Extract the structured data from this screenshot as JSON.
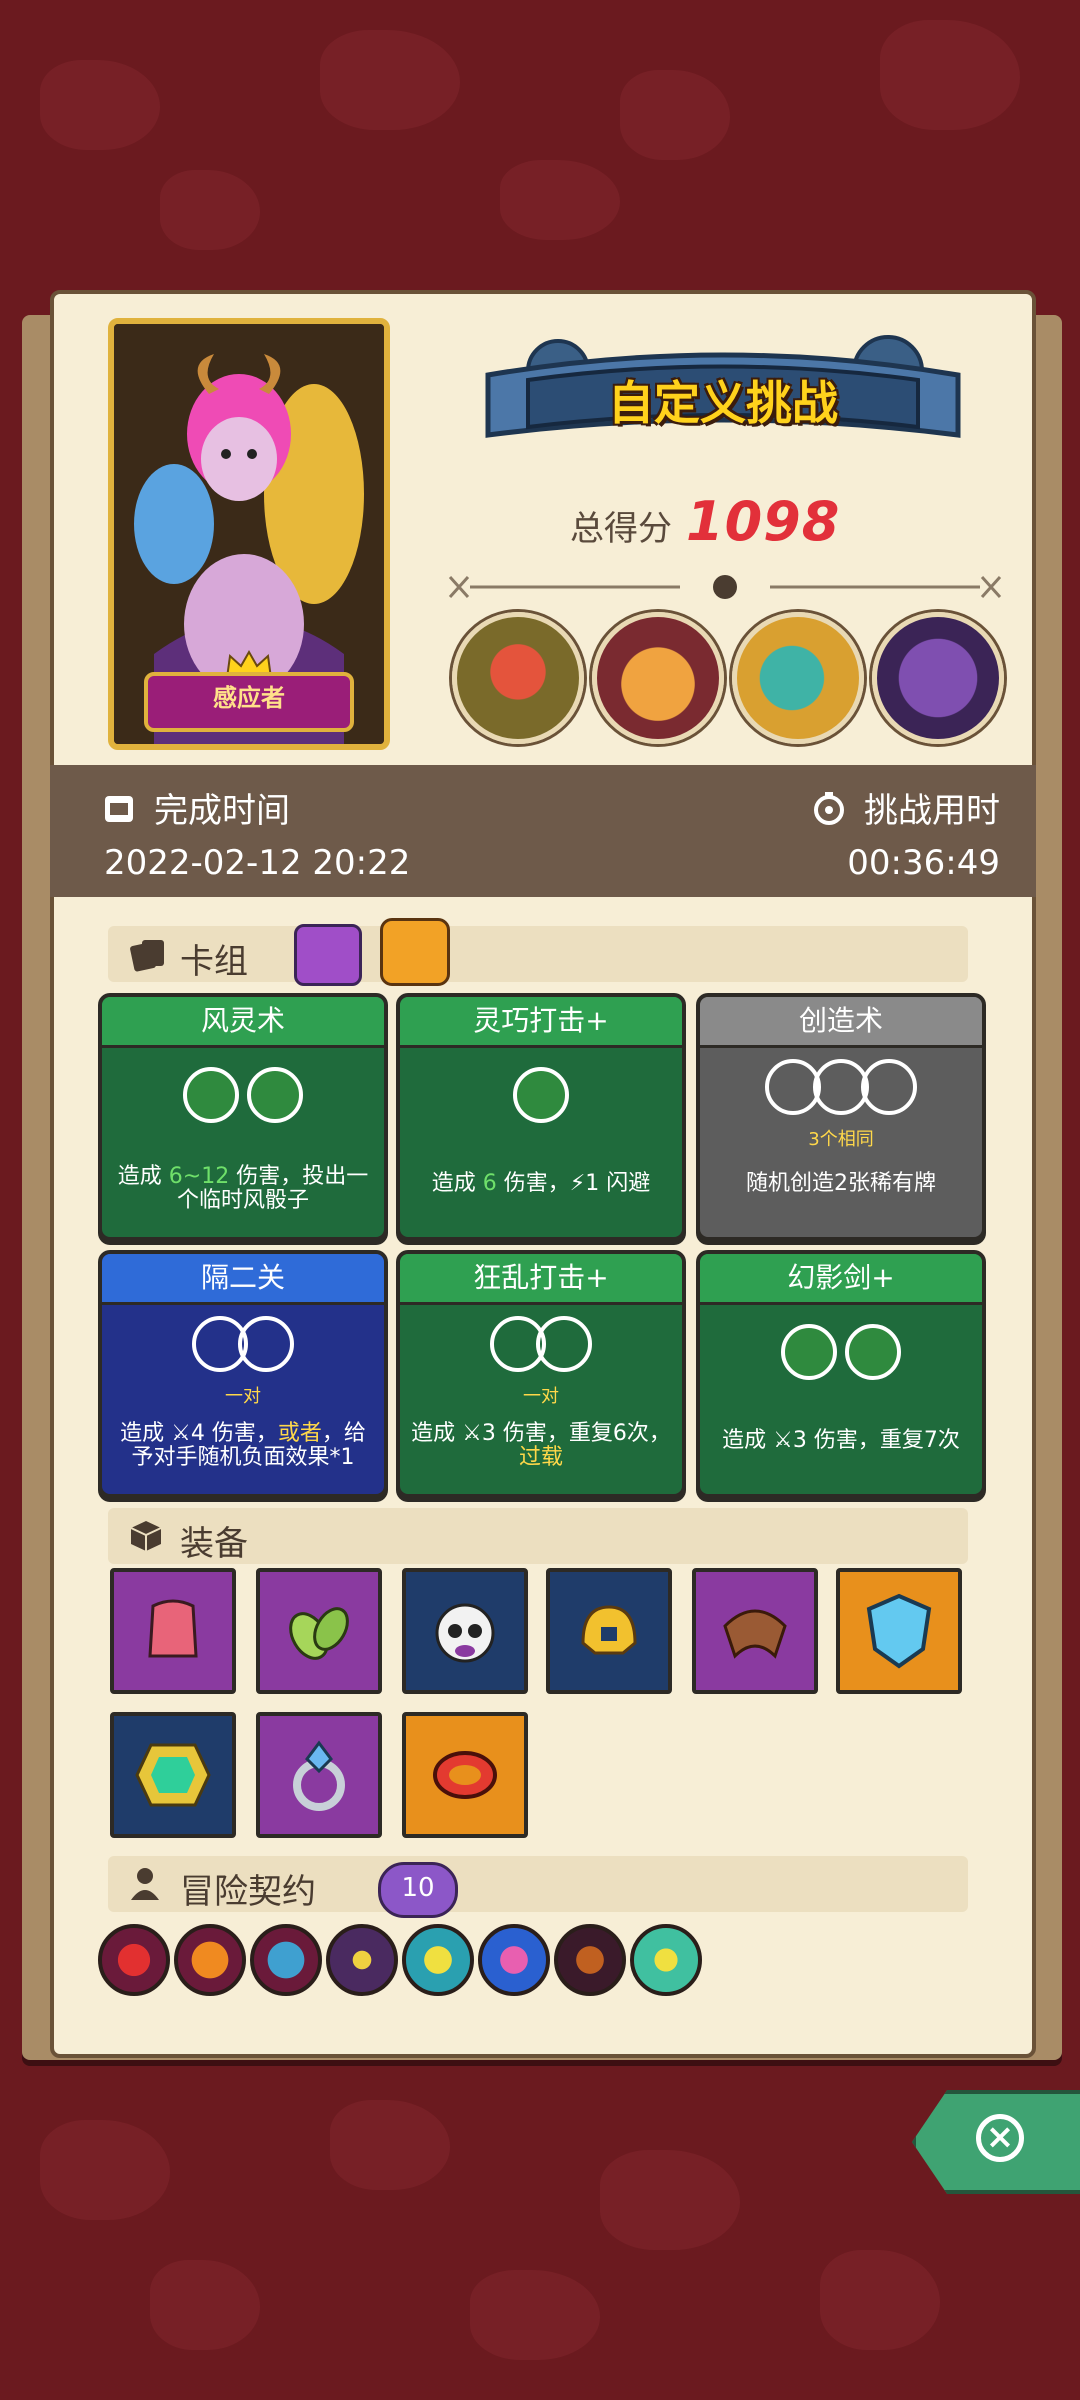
{
  "hero": {
    "name": "感应者"
  },
  "banner": {
    "title": "自定义挑战"
  },
  "score": {
    "label": "总得分",
    "value": "1098"
  },
  "bosses": [
    "boss-eye-icon",
    "boss-pig-icon",
    "boss-bird-icon",
    "boss-dragon-icon"
  ],
  "stats": {
    "finish_label": "完成时间",
    "finish_value": "2022-02-12 20:22",
    "duration_label": "挑战用时",
    "duration_value": "00:36:49"
  },
  "deck": {
    "title": "卡组",
    "cards": [
      {
        "name": "风灵术",
        "color": "green",
        "slots": "2 filled",
        "sub": "",
        "desc_a": "造成 ",
        "desc_hl": "6~12",
        "desc_b": " 伤害，投出一个临时风骰子"
      },
      {
        "name": "灵巧打击+",
        "color": "green",
        "slots": "1 filled",
        "sub": "",
        "desc_a": "造成 ",
        "desc_hl": "6",
        "desc_b": " 伤害，⚡1 闪避"
      },
      {
        "name": "创造术",
        "color": "gray",
        "slots": "3 empty",
        "sub": "3个相同",
        "desc_a": "随机创造2张稀有牌",
        "desc_hl": "",
        "desc_b": ""
      },
      {
        "name": "隔二关",
        "color": "blue",
        "slots": "2 empty",
        "sub": "一对",
        "desc_a": "造成 ⚔4 伤害，",
        "desc_hl": "或者",
        "desc_b": "，给予对手随机负面效果*1"
      },
      {
        "name": "狂乱打击+",
        "color": "green",
        "slots": "2 empty",
        "sub": "一对",
        "desc_a": "造成 ⚔3 伤害，重复6次，",
        "desc_hl": "过载",
        "desc_b": ""
      },
      {
        "name": "幻影剑+",
        "color": "green",
        "slots": "2 filled",
        "sub": "",
        "desc_a": "造成 ⚔3 伤害，重复7次",
        "desc_hl": "",
        "desc_b": ""
      }
    ]
  },
  "equipment": {
    "title": "装备",
    "items": [
      {
        "name": "pink-cloak-icon",
        "color": "purple"
      },
      {
        "name": "leaf-icon",
        "color": "purple"
      },
      {
        "name": "skull-mask-icon",
        "color": "navy"
      },
      {
        "name": "golden-helmet-icon",
        "color": "navy"
      },
      {
        "name": "leather-bracer-icon",
        "color": "purple"
      },
      {
        "name": "blue-shield-icon",
        "color": "orange"
      },
      {
        "name": "emerald-icon",
        "color": "navy"
      },
      {
        "name": "diamond-ring-icon",
        "color": "purple"
      },
      {
        "name": "red-ring-icon",
        "color": "orange"
      }
    ]
  },
  "contract": {
    "title": "冒险契约",
    "level": "10",
    "icons": [
      "contract-rune-icon",
      "contract-fire-icon",
      "contract-mushroom-icon",
      "contract-dark-icon",
      "contract-storm-icon",
      "contract-vortex-icon",
      "contract-pipe-icon",
      "contract-eye-icon"
    ]
  },
  "colors": {
    "score": "#e2303a",
    "banner_text": "#ffd21c",
    "panel": "#f7eed6",
    "background": "#6b1a1f"
  }
}
